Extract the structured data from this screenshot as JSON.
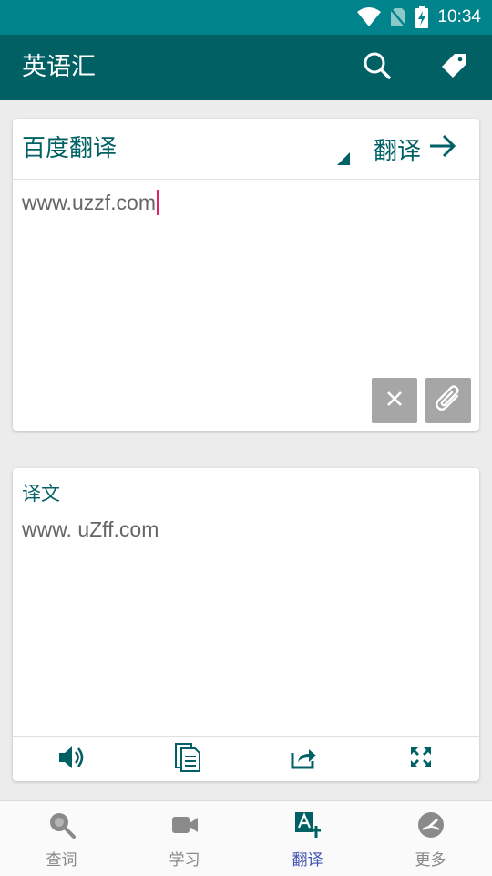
{
  "status_bar": {
    "time": "10:34",
    "icons": [
      "wifi-icon",
      "no-sim-icon",
      "battery-charging-icon"
    ]
  },
  "app_bar": {
    "title": "英语汇",
    "actions": [
      "search-icon",
      "tag-icon"
    ]
  },
  "input_card": {
    "engine": "百度翻译",
    "translate_label": "翻译",
    "input_value": "www.uzzf.com",
    "buttons": [
      "close-icon",
      "paperclip-icon"
    ]
  },
  "output_card": {
    "label": "译文",
    "result": "www. uZff.com",
    "toolbar": [
      "speaker-icon",
      "copy-icon",
      "share-icon",
      "fullscreen-icon"
    ]
  },
  "bottom_nav": {
    "items": [
      {
        "label": "查词",
        "icon": "search-icon",
        "active": false
      },
      {
        "label": "学习",
        "icon": "video-icon",
        "active": false
      },
      {
        "label": "翻译",
        "icon": "translate-icon",
        "active": true
      },
      {
        "label": "更多",
        "icon": "more-icon",
        "active": false
      }
    ]
  },
  "colors": {
    "primary": "#006064",
    "status_bar": "#00838a",
    "active_tab": "#3f51b5",
    "caret": "#e91e63"
  }
}
